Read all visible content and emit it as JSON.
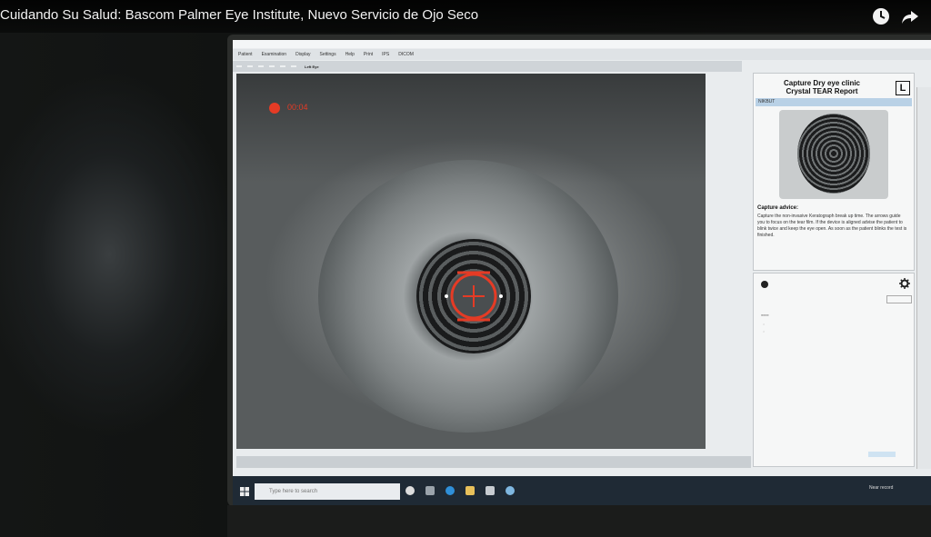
{
  "video": {
    "title": "Cuidando Su Salud: Bascom Palmer Eye Institute, Nuevo Servicio de Ojo Seco",
    "icons": [
      "clock-icon",
      "share-icon"
    ]
  },
  "app": {
    "menu": [
      "Patient",
      "Examination",
      "Display",
      "Settings",
      "Help",
      "Print",
      "IPS",
      "DICOM"
    ],
    "eye_label": "Left Eye",
    "recording_time": "00:04",
    "report": {
      "title_line1": "Capture Dry eye clinic",
      "title_line2": "Crystal TEAR Report",
      "eye_badge": "L",
      "strip_label": "NIKBUT",
      "advice_title": "Capture advice:",
      "advice_text": "Capture the non-invasive Keratograph break up time. The arrows guide you to focus on the tear film. If the device is aligned advise the patient to blink twice and keep the eye open. As soon as the patient blinks the test is finished."
    }
  },
  "taskbar": {
    "search_placeholder": "Type here to search",
    "near_record": "Near record"
  },
  "colors": {
    "reticle": "#e53b25",
    "taskbar": "#1f2a35",
    "selection_strip": "#b9d1e6"
  }
}
